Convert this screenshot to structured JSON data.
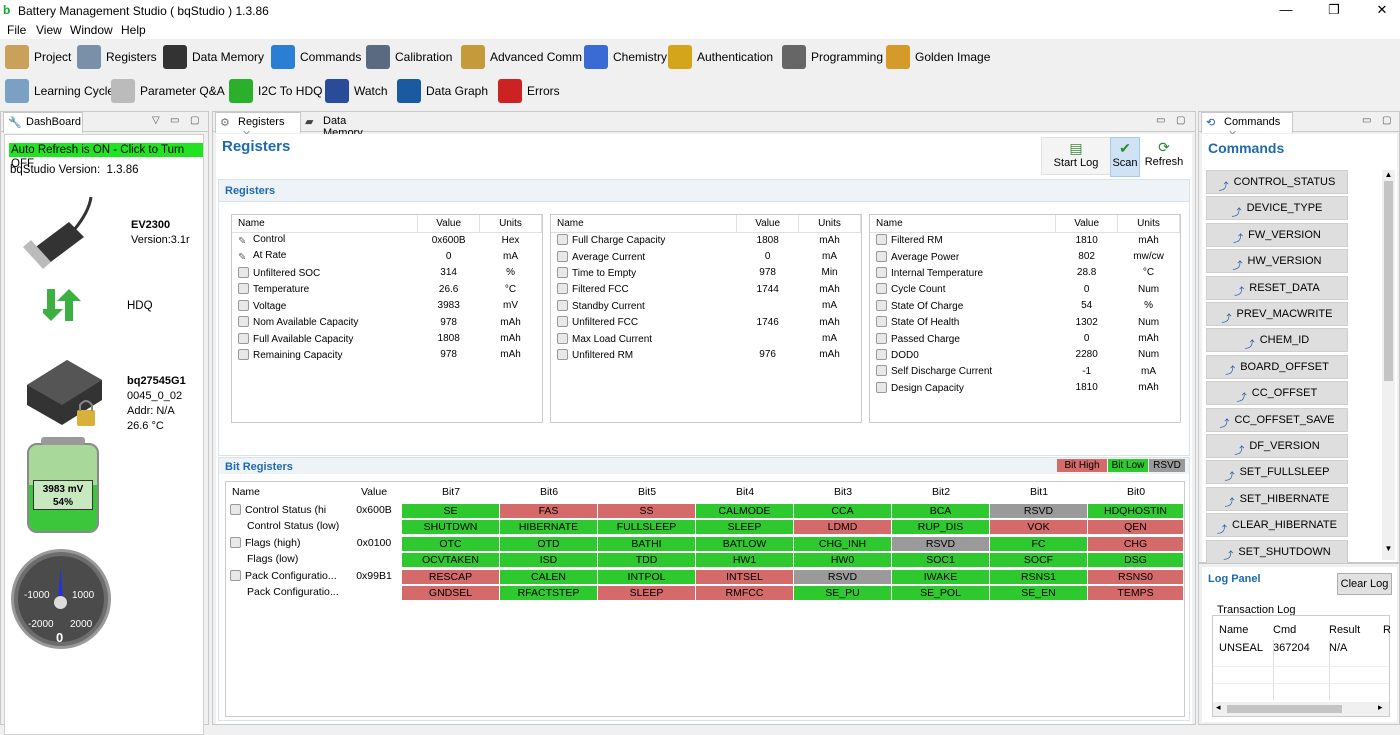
{
  "window": {
    "title": "Battery Management Studio ( bqStudio ) 1.3.86",
    "minimize": "—",
    "restore": "❐",
    "close": "✕"
  },
  "menu": [
    "File",
    "View",
    "Window",
    "Help"
  ],
  "toolbar": {
    "row1": [
      {
        "label": "Project",
        "icon": "clipboard-icon"
      },
      {
        "label": "Registers",
        "icon": "gear-icon"
      },
      {
        "label": "Data Memory",
        "icon": "memory-chip-icon"
      },
      {
        "label": "Commands",
        "icon": "refresh-arrows-icon"
      },
      {
        "label": "Calibration",
        "icon": "magnifier-icon"
      },
      {
        "label": "Advanced Comm",
        "icon": "package-icon"
      },
      {
        "label": "Chemistry",
        "icon": "flask-icon"
      },
      {
        "label": "Authentication",
        "icon": "padlock-icon"
      },
      {
        "label": "Programming",
        "icon": "binary-file-icon"
      },
      {
        "label": "Golden Image",
        "icon": "chip-icon"
      }
    ],
    "row2": [
      {
        "label": "Learning Cycle",
        "icon": "clipboard-chart-icon"
      },
      {
        "label": "Parameter Q&A",
        "icon": "question-doc-icon"
      },
      {
        "label": "I2C To HDQ",
        "icon": "hdq-arrows-icon"
      },
      {
        "label": "Watch",
        "icon": "book-icon"
      },
      {
        "label": "Data Graph",
        "icon": "graph-monitor-icon"
      },
      {
        "label": "Errors",
        "icon": "error-doc-icon"
      }
    ]
  },
  "dashboard": {
    "tab": "DashBoard",
    "auto_refresh": "Auto Refresh is ON - Click to Turn OFF",
    "version_label": "bqStudio Version:",
    "version": "1.3.86",
    "adapter": "EV2300",
    "adapter_version": "Version:3.1r",
    "protocol": "HDQ",
    "device": "bq27545G1",
    "fw": "0045_0_02",
    "addr": "Addr: N/A",
    "temp": "26.6 °C",
    "battery_mv": "3983 mV",
    "battery_pct": "54%",
    "battery_level": 0.54,
    "gauge": {
      "labels": [
        "-1000",
        "1000",
        "-2000",
        "2000"
      ],
      "value": "0"
    }
  },
  "registers": {
    "tab": "Registers",
    "tab2": "Data Memory",
    "title": "Registers",
    "section": "Registers",
    "start_log": "Start Log",
    "scan": "Scan",
    "refresh": "Refresh",
    "headers": [
      "Name",
      "Value",
      "Units"
    ],
    "col1": [
      {
        "i": "pen",
        "n": "Control",
        "v": "0x600B",
        "u": "Hex"
      },
      {
        "i": "pen",
        "n": "At Rate",
        "v": "0",
        "u": "mA"
      },
      {
        "i": "lock",
        "n": "Unfiltered SOC",
        "v": "314",
        "u": "%"
      },
      {
        "i": "lock",
        "n": "Temperature",
        "v": "26.6",
        "u": "°C"
      },
      {
        "i": "lock",
        "n": "Voltage",
        "v": "3983",
        "u": "mV"
      },
      {
        "i": "lock",
        "n": "Nom Available Capacity",
        "v": "978",
        "u": "mAh"
      },
      {
        "i": "lock",
        "n": "Full Available Capacity",
        "v": "1808",
        "u": "mAh"
      },
      {
        "i": "lock",
        "n": "Remaining Capacity",
        "v": "978",
        "u": "mAh"
      }
    ],
    "col2": [
      {
        "i": "lock",
        "n": "Full Charge Capacity",
        "v": "1808",
        "u": "mAh"
      },
      {
        "i": "lock",
        "n": "Average Current",
        "v": "0",
        "u": "mA"
      },
      {
        "i": "lock",
        "n": "Time to Empty",
        "v": "978",
        "u": "Min"
      },
      {
        "i": "lock",
        "n": "Filtered FCC",
        "v": "1744",
        "u": "mAh"
      },
      {
        "i": "lock",
        "n": "Standby Current",
        "v": "",
        "u": "mA"
      },
      {
        "i": "lock",
        "n": "Unfiltered FCC",
        "v": "1746",
        "u": "mAh"
      },
      {
        "i": "lock",
        "n": "Max Load Current",
        "v": "",
        "u": "mA"
      },
      {
        "i": "lock",
        "n": "Unfiltered RM",
        "v": "976",
        "u": "mAh"
      }
    ],
    "col3": [
      {
        "i": "lock",
        "n": "Filtered RM",
        "v": "1810",
        "u": "mAh"
      },
      {
        "i": "lock",
        "n": "Average Power",
        "v": "802",
        "u": "mw/cw"
      },
      {
        "i": "lock",
        "n": "Internal Temperature",
        "v": "28.8",
        "u": "°C"
      },
      {
        "i": "lock",
        "n": "Cycle Count",
        "v": "0",
        "u": "Num"
      },
      {
        "i": "lock",
        "n": "State Of Charge",
        "v": "54",
        "u": "%"
      },
      {
        "i": "lock",
        "n": "State Of Health",
        "v": "1302",
        "u": "Num"
      },
      {
        "i": "lock",
        "n": "Passed Charge",
        "v": "0",
        "u": "mAh"
      },
      {
        "i": "lock",
        "n": "DOD0",
        "v": "2280",
        "u": "Num"
      },
      {
        "i": "lock",
        "n": "Self Discharge Current",
        "v": "-1",
        "u": "mA"
      },
      {
        "i": "lock",
        "n": "Design Capacity",
        "v": "1810",
        "u": "mAh"
      }
    ]
  },
  "bits": {
    "section": "Bit Registers",
    "legend": [
      "Bit High",
      "Bit Low",
      "RSVD"
    ],
    "headers": [
      "Name",
      "Value",
      "Bit7",
      "Bit6",
      "Bit5",
      "Bit4",
      "Bit3",
      "Bit2",
      "Bit1",
      "Bit0"
    ],
    "rows": [
      {
        "lock": true,
        "n": "Control Status (hi",
        "v": "0x600B",
        "b": [
          [
            "SE",
            "g"
          ],
          [
            "FAS",
            "r"
          ],
          [
            "SS",
            "r"
          ],
          [
            "CALMODE",
            "g"
          ],
          [
            "CCA",
            "g"
          ],
          [
            "BCA",
            "g"
          ],
          [
            "RSVD",
            "gr"
          ],
          [
            "HDQHOSTIN",
            "g"
          ]
        ]
      },
      {
        "lock": false,
        "n": "Control Status (low)",
        "v": "",
        "b": [
          [
            "SHUTDWN",
            "g"
          ],
          [
            "HIBERNATE",
            "g"
          ],
          [
            "FULLSLEEP",
            "g"
          ],
          [
            "SLEEP",
            "g"
          ],
          [
            "LDMD",
            "r"
          ],
          [
            "RUP_DIS",
            "g"
          ],
          [
            "VOK",
            "r"
          ],
          [
            "QEN",
            "r"
          ]
        ]
      },
      {
        "lock": true,
        "n": "Flags (high)",
        "v": "0x0100",
        "b": [
          [
            "OTC",
            "g"
          ],
          [
            "OTD",
            "g"
          ],
          [
            "BATHI",
            "g"
          ],
          [
            "BATLOW",
            "g"
          ],
          [
            "CHG_INH",
            "g"
          ],
          [
            "RSVD",
            "gr"
          ],
          [
            "FC",
            "g"
          ],
          [
            "CHG",
            "r"
          ]
        ]
      },
      {
        "lock": false,
        "n": "Flags (low)",
        "v": "",
        "b": [
          [
            "OCVTAKEN",
            "g"
          ],
          [
            "ISD",
            "g"
          ],
          [
            "TDD",
            "g"
          ],
          [
            "HW1",
            "g"
          ],
          [
            "HW0",
            "g"
          ],
          [
            "SOC1",
            "g"
          ],
          [
            "SOCF",
            "g"
          ],
          [
            "DSG",
            "g"
          ]
        ]
      },
      {
        "lock": true,
        "n": "Pack Configuratio...",
        "v": "0x99B1",
        "b": [
          [
            "RESCAP",
            "r"
          ],
          [
            "CALEN",
            "g"
          ],
          [
            "INTPOL",
            "g"
          ],
          [
            "INTSEL",
            "r"
          ],
          [
            "RSVD",
            "gr"
          ],
          [
            "IWAKE",
            "g"
          ],
          [
            "RSNS1",
            "g"
          ],
          [
            "RSNS0",
            "r"
          ]
        ]
      },
      {
        "lock": false,
        "n": "Pack Configuratio...",
        "v": "",
        "b": [
          [
            "GNDSEL",
            "r"
          ],
          [
            "RFACTSTEP",
            "g"
          ],
          [
            "SLEEP",
            "r"
          ],
          [
            "RMFCC",
            "r"
          ],
          [
            "SE_PU",
            "g"
          ],
          [
            "SE_POL",
            "g"
          ],
          [
            "SE_EN",
            "g"
          ],
          [
            "TEMPS",
            "r"
          ]
        ]
      }
    ]
  },
  "commands": {
    "tab": "Commands",
    "title": "Commands",
    "items": [
      "CONTROL_STATUS",
      "DEVICE_TYPE",
      "FW_VERSION",
      "HW_VERSION",
      "RESET_DATA",
      "PREV_MACWRITE",
      "CHEM_ID",
      "BOARD_OFFSET",
      "CC_OFFSET",
      "CC_OFFSET_SAVE",
      "DF_VERSION",
      "SET_FULLSLEEP",
      "SET_HIBERNATE",
      "CLEAR_HIBERNATE",
      "SET_SHUTDOWN"
    ]
  },
  "log": {
    "title": "Log Panel",
    "clear": "Clear Log",
    "subtitle": "Transaction Log",
    "headers": [
      "Name",
      "Cmd",
      "Result",
      "R"
    ],
    "rows": [
      [
        "UNSEAL",
        "367204",
        "N/A",
        ""
      ]
    ]
  }
}
